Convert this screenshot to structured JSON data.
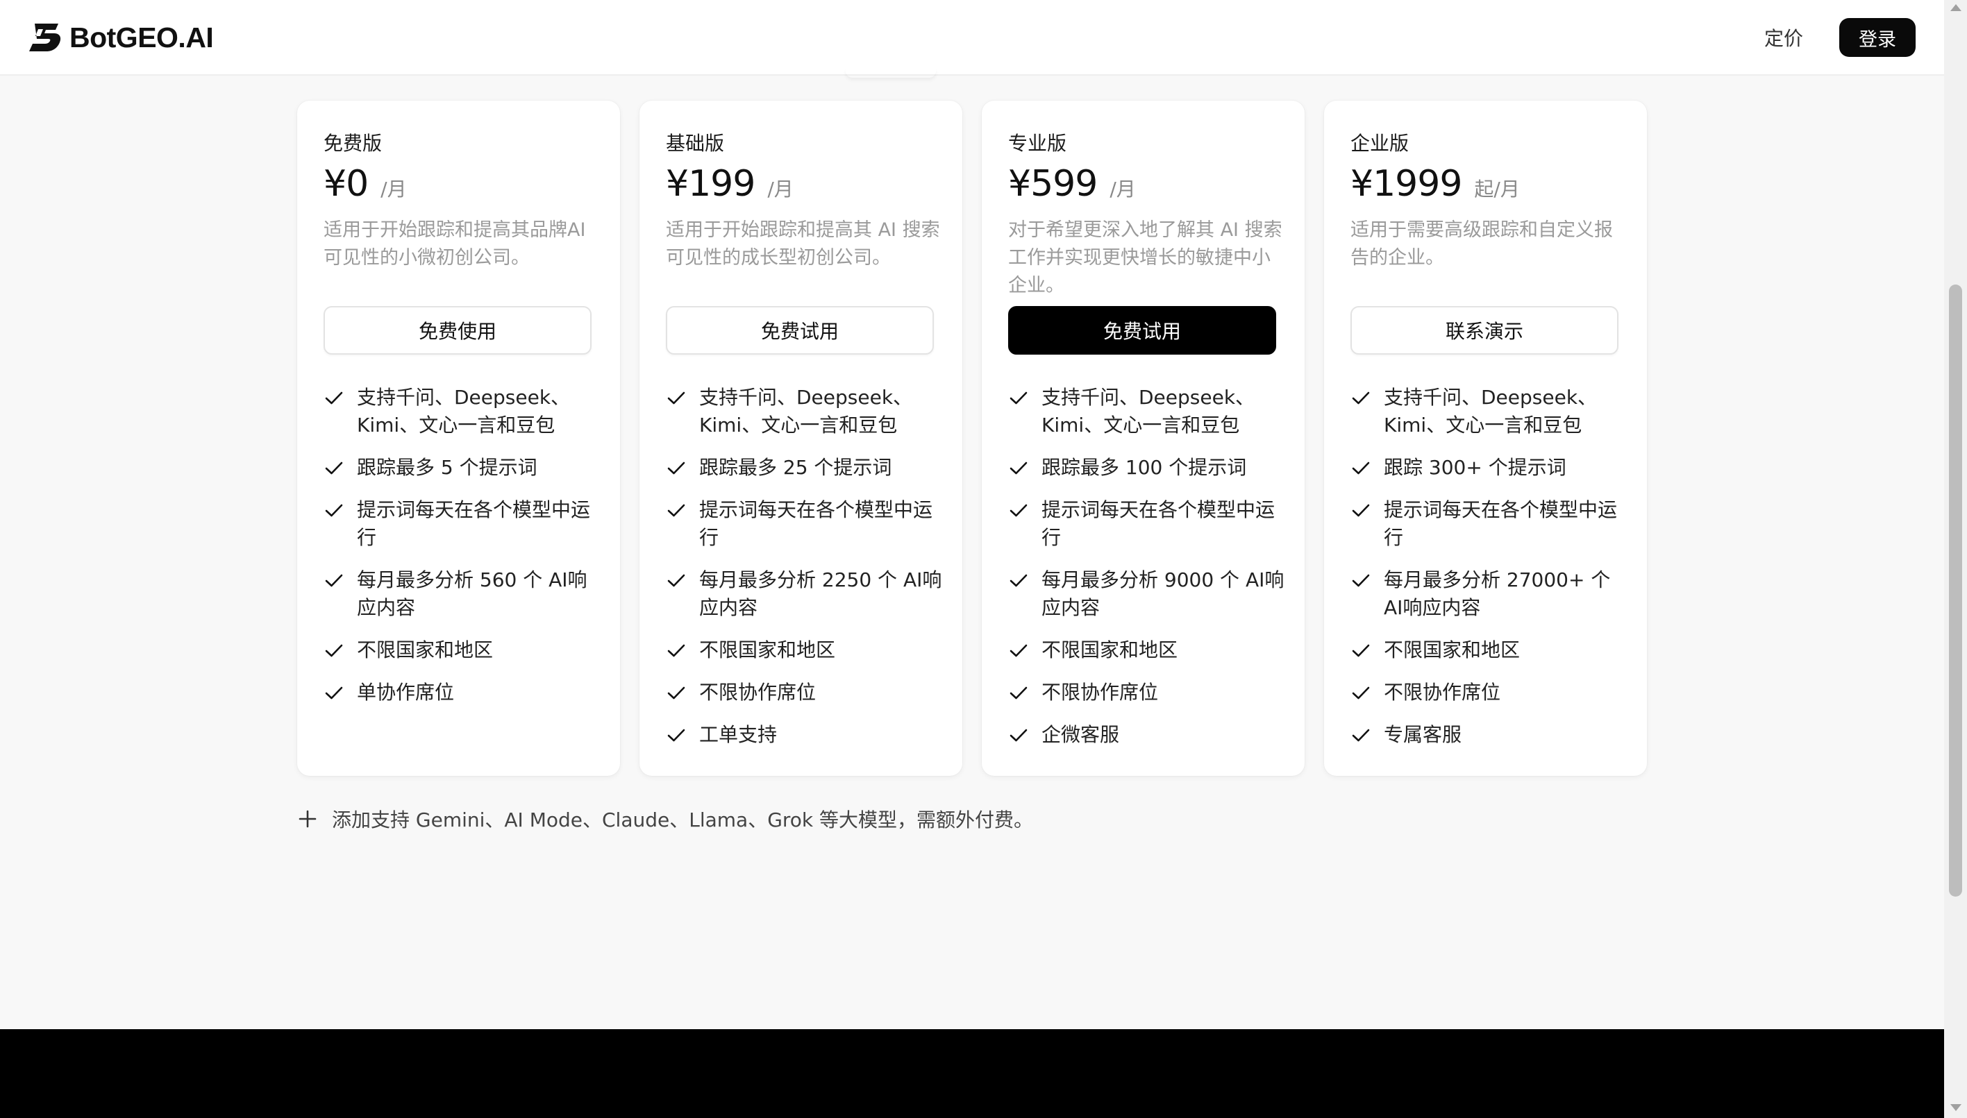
{
  "header": {
    "brand": "BotGEO.AI",
    "logo_icon": "botgeo-logo-icon",
    "nav_pricing": "定价",
    "login": "登录"
  },
  "plans": [
    {
      "name": "免费版",
      "price": "¥0",
      "unit": "/月",
      "description": "适用于开始跟踪和提高其品牌AI可见性的小微初创公司。",
      "cta": "免费使用",
      "cta_primary": false,
      "features": [
        "支持千问、Deepseek、Kimi、文心一言和豆包",
        "跟踪最多 5 个提示词",
        "提示词每天在各个模型中运行",
        "每月最多分析 560 个 AI响应内容",
        "不限国家和地区",
        "单协作席位"
      ]
    },
    {
      "name": "基础版",
      "price": "¥199",
      "unit": "/月",
      "description": "适用于开始跟踪和提高其 AI 搜索可见性的成长型初创公司。",
      "cta": "免费试用",
      "cta_primary": false,
      "features": [
        "支持千问、Deepseek、Kimi、文心一言和豆包",
        "跟踪最多 25 个提示词",
        "提示词每天在各个模型中运行",
        "每月最多分析 2250 个 AI响应内容",
        "不限国家和地区",
        "不限协作席位",
        "工单支持"
      ]
    },
    {
      "name": "专业版",
      "price": "¥599",
      "unit": "/月",
      "description": "对于希望更深入地了解其 AI 搜索工作并实现更快增长的敏捷中小企业。",
      "cta": "免费试用",
      "cta_primary": true,
      "features": [
        "支持千问、Deepseek、Kimi、文心一言和豆包",
        "跟踪最多 100 个提示词",
        "提示词每天在各个模型中运行",
        "每月最多分析 9000 个 AI响应内容",
        "不限国家和地区",
        "不限协作席位",
        "企微客服"
      ]
    },
    {
      "name": "企业版",
      "price": "¥1999",
      "unit": "起/月",
      "description": "适用于需要高级跟踪和自定义报告的企业。",
      "cta": "联系演示",
      "cta_primary": false,
      "features": [
        "支持千问、Deepseek、Kimi、文心一言和豆包",
        "跟踪 300+ 个提示词",
        "提示词每天在各个模型中运行",
        "每月最多分析 27000+ 个 AI响应内容",
        "不限国家和地区",
        "不限协作席位",
        "专属客服"
      ]
    }
  ],
  "addon": {
    "icon": "plus-icon",
    "text": "添加支持 Gemini、AI Mode、Claude、Llama、Grok 等大模型，需额外付费。"
  },
  "icons": {
    "feature": "check-icon"
  },
  "colors": {
    "primary": "#000000",
    "background": "#f8f8f8",
    "card": "#ffffff",
    "muted_text": "#9a9a9a"
  }
}
